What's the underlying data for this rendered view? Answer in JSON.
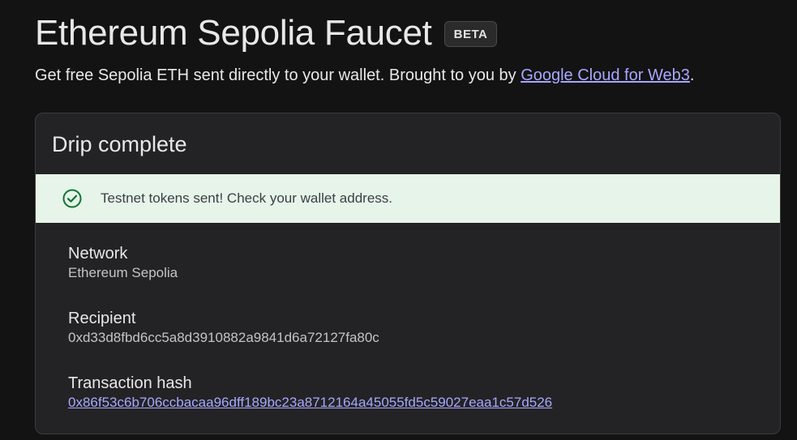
{
  "header": {
    "title": "Ethereum Sepolia Faucet",
    "badge": "BETA",
    "subtitle_text": "Get free Sepolia ETH sent directly to your wallet. Brought to you by ",
    "subtitle_link": "Google Cloud for Web3",
    "subtitle_end": "."
  },
  "card": {
    "title": "Drip complete",
    "banner": {
      "icon": "check-circle-icon",
      "message": "Testnet tokens sent! Check your wallet address."
    },
    "network": {
      "label": "Network",
      "value": "Ethereum Sepolia"
    },
    "recipient": {
      "label": "Recipient",
      "value": "0xd33d8fbd6cc5a8d3910882a9841d6a72127fa80c"
    },
    "transaction": {
      "label": "Transaction hash",
      "value": "0x86f53c6b706ccbacaa96dff189bc23a8712164a45055fd5c59027eaa1c57d526"
    }
  },
  "colors": {
    "background": "#131313",
    "card": "#232325",
    "link": "#a8a7ff",
    "success_bg": "#e6f4ea",
    "success_icon": "#137333"
  }
}
